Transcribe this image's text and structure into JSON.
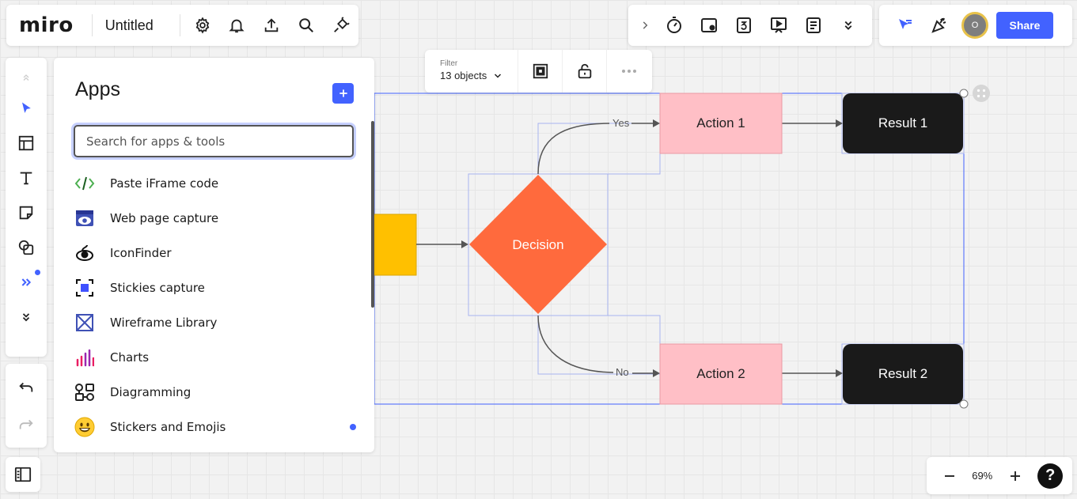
{
  "app": {
    "logo": "miro",
    "board_title": "Untitled"
  },
  "top_bar_left": {
    "icons": [
      "gear-icon",
      "bell-icon",
      "upload-icon",
      "search-icon",
      "plug-icon"
    ]
  },
  "top_bar_mid": {
    "icons": [
      "chevron-right-icon",
      "timer-icon",
      "card-icon",
      "countdown-icon",
      "presentation-icon",
      "notes-icon",
      "chevron-double-down-icon"
    ]
  },
  "top_bar_right": {
    "avatar_initial": "O",
    "share_label": "Share"
  },
  "left_toolbar": {
    "tools": [
      "select",
      "templates",
      "text",
      "sticky-note",
      "shapes",
      "more-tools",
      "collapse"
    ]
  },
  "apps_panel": {
    "title": "Apps",
    "search_placeholder": "Search for apps & tools",
    "items": [
      {
        "label": "Paste iFrame code",
        "icon": "code-icon"
      },
      {
        "label": "Web page capture",
        "icon": "web-capture-icon"
      },
      {
        "label": "IconFinder",
        "icon": "iconfinder-icon"
      },
      {
        "label": "Stickies capture",
        "icon": "stickies-capture-icon"
      },
      {
        "label": "Wireframe Library",
        "icon": "wireframe-icon"
      },
      {
        "label": "Charts",
        "icon": "charts-icon"
      },
      {
        "label": "Diagramming",
        "icon": "diagramming-icon"
      },
      {
        "label": "Stickers and Emojis",
        "icon": "emoji-icon",
        "has_new_badge": true
      }
    ]
  },
  "selection_toolbar": {
    "filter_label": "Filter",
    "object_count": "13 objects"
  },
  "flowchart": {
    "decision": "Decision",
    "action_1": "Action 1",
    "action_2": "Action 2",
    "result_1": "Result 1",
    "result_2": "Result 2",
    "yes_label": "Yes",
    "no_label": "No"
  },
  "colors": {
    "accent": "#4262ff",
    "decision": "#ff6a3d",
    "action": "#ffbfc6",
    "result": "#1a1a1a",
    "start": "#ffc000",
    "selection": "#4262ff"
  },
  "zoom": {
    "level": "69%"
  }
}
